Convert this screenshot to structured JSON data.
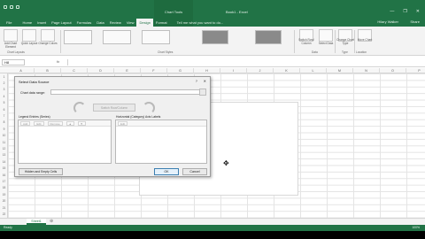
{
  "window": {
    "chart_tools": "Chart Tools",
    "doc_title": "Book1 - Excel",
    "user": "Hilary Walker",
    "share": "Share",
    "minimize": "—",
    "restore": "❐",
    "close": "✕"
  },
  "tabs": [
    "File",
    "Home",
    "Insert",
    "Page Layout",
    "Formulas",
    "Data",
    "Review",
    "View",
    "Design",
    "Format"
  ],
  "active_tab": "Design",
  "tell_me": "Tell me what you want to do...",
  "ribbon": {
    "add_chart_element": "Add Chart Element",
    "quick_layout": "Quick Layout",
    "change_colors": "Change Colors",
    "switch_row_col": "Switch Row/ Column",
    "select_data": "Select Data",
    "change_chart_type": "Change Chart Type",
    "move_chart": "Move Chart",
    "groups": {
      "chart_layouts": "Chart Layouts",
      "chart_styles": "Chart Styles",
      "data": "Data",
      "type": "Type",
      "location": "Location"
    }
  },
  "formula_bar": {
    "name_box": "H8",
    "fx": "fx"
  },
  "columns": [
    "A",
    "B",
    "C",
    "D",
    "E",
    "F",
    "G",
    "H",
    "I",
    "J",
    "K",
    "L",
    "M",
    "N",
    "O",
    "P"
  ],
  "rows": [
    "1",
    "2",
    "3",
    "4",
    "5",
    "6",
    "7",
    "8",
    "9",
    "10",
    "11",
    "12",
    "13",
    "14",
    "15",
    "16",
    "17",
    "18",
    "19",
    "20",
    "21",
    "22"
  ],
  "dialog": {
    "title": "Select Data Source",
    "help": "?",
    "close": "✕",
    "range_label": "Chart data range:",
    "switch_button": "Switch Row/Column",
    "legend_label": "Legend Entries (Series)",
    "legend_tools": [
      "Add",
      "Edit",
      "Remove"
    ],
    "axis_label": "Horizontal (Category) Axis Labels",
    "axis_tools": [
      "Edit"
    ],
    "hidden_empty": "Hidden and Empty Cells",
    "ok": "OK",
    "cancel": "Cancel"
  },
  "sheet": {
    "tab": "Sheet1",
    "add": "⊕"
  },
  "status": {
    "left": "Ready",
    "zoom": "100%"
  }
}
